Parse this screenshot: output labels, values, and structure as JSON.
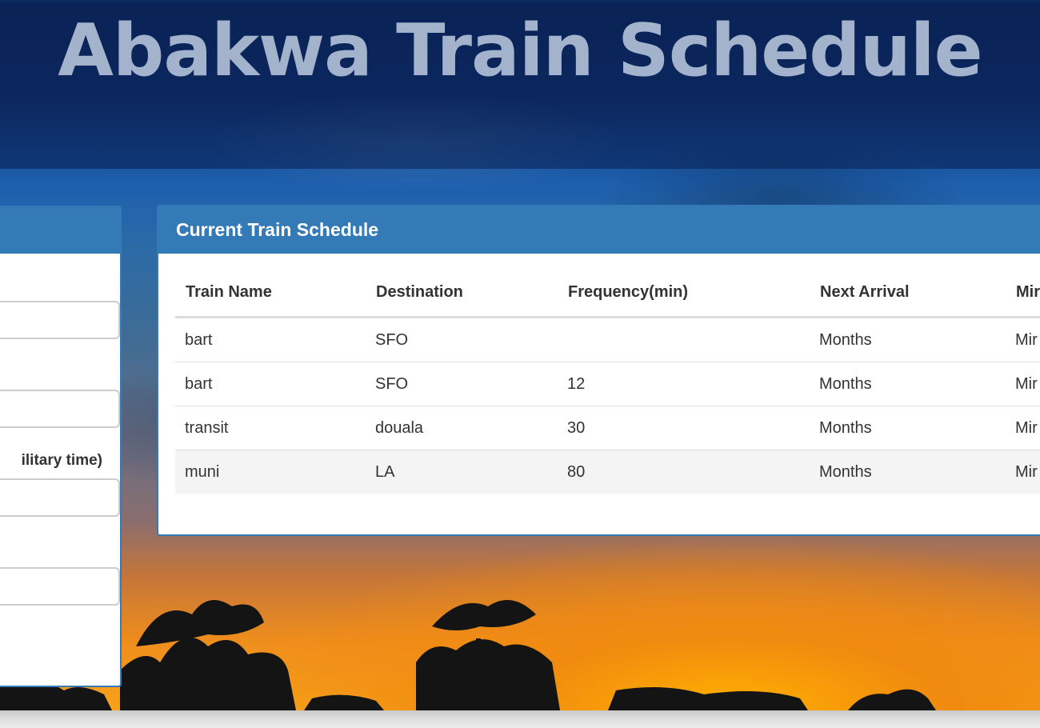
{
  "header": {
    "title": "Abakwa Train Schedule"
  },
  "add_train_panel": {
    "field_3_label_fragment": "ilitary time)",
    "fields": [
      {
        "value": "",
        "placeholder": ""
      },
      {
        "value": "",
        "placeholder": ""
      },
      {
        "value": "",
        "placeholder": ""
      },
      {
        "value": "",
        "placeholder": ""
      }
    ]
  },
  "schedule_panel": {
    "title": "Current Train Schedule",
    "columns": [
      "Train Name",
      "Destination",
      "Frequency(min)",
      "Next Arrival",
      "Mir"
    ],
    "rows": [
      {
        "name": "bart",
        "destination": "SFO",
        "frequency": "",
        "next_arrival": "Months",
        "minutes": "Mir"
      },
      {
        "name": "bart",
        "destination": "SFO",
        "frequency": "12",
        "next_arrival": "Months",
        "minutes": "Mir"
      },
      {
        "name": "transit",
        "destination": "douala",
        "frequency": "30",
        "next_arrival": "Months",
        "minutes": "Mir"
      },
      {
        "name": "muni",
        "destination": "LA",
        "frequency": "80",
        "next_arrival": "Months",
        "minutes": "Mir"
      }
    ]
  },
  "colors": {
    "panel_primary": "#337ab7",
    "text": "#333333",
    "title_overlay": "#becde1"
  }
}
